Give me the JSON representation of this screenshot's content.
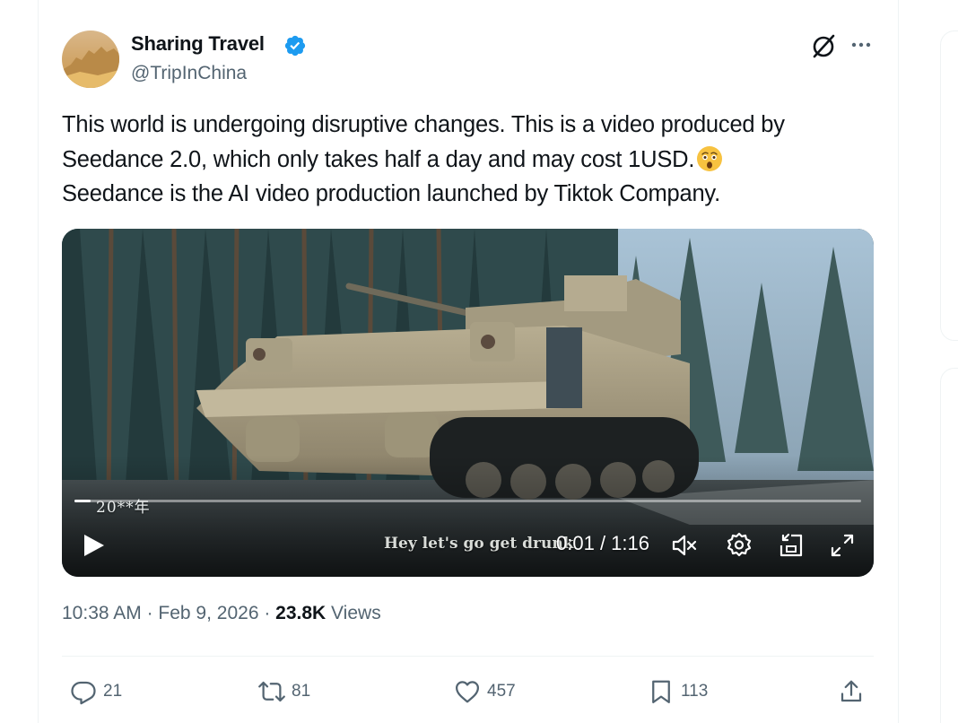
{
  "author": {
    "display_name": "Sharing Travel",
    "handle": "@TripInChina",
    "verified": true
  },
  "tweet": {
    "lines": [
      "This world is undergoing disruptive changes. This is a video produced by",
      "Seedance 2.0, which only takes half a day and may cost 1USD.",
      "Seedance is the AI video production launched by Tiktok Company."
    ],
    "emoji": "astonished-face"
  },
  "video": {
    "burned_subtitle": "20**年",
    "overlay_caption": "Hey let's go get drunk",
    "current_time": "0:01",
    "duration": "1:16",
    "time_separator": " / ",
    "progress_fraction": 0.02,
    "muted": true
  },
  "meta": {
    "time": "10:38 AM",
    "separator": " · ",
    "date": "Feb 9, 2026",
    "views_count": "23.8K",
    "views_label": " Views"
  },
  "actions": {
    "replies": "21",
    "reposts": "81",
    "likes": "457",
    "bookmarks": "113"
  },
  "colors": {
    "text_primary": "#0f1419",
    "text_secondary": "#536471",
    "verified_blue": "#1d9bf0",
    "divider": "#eff3f4"
  }
}
